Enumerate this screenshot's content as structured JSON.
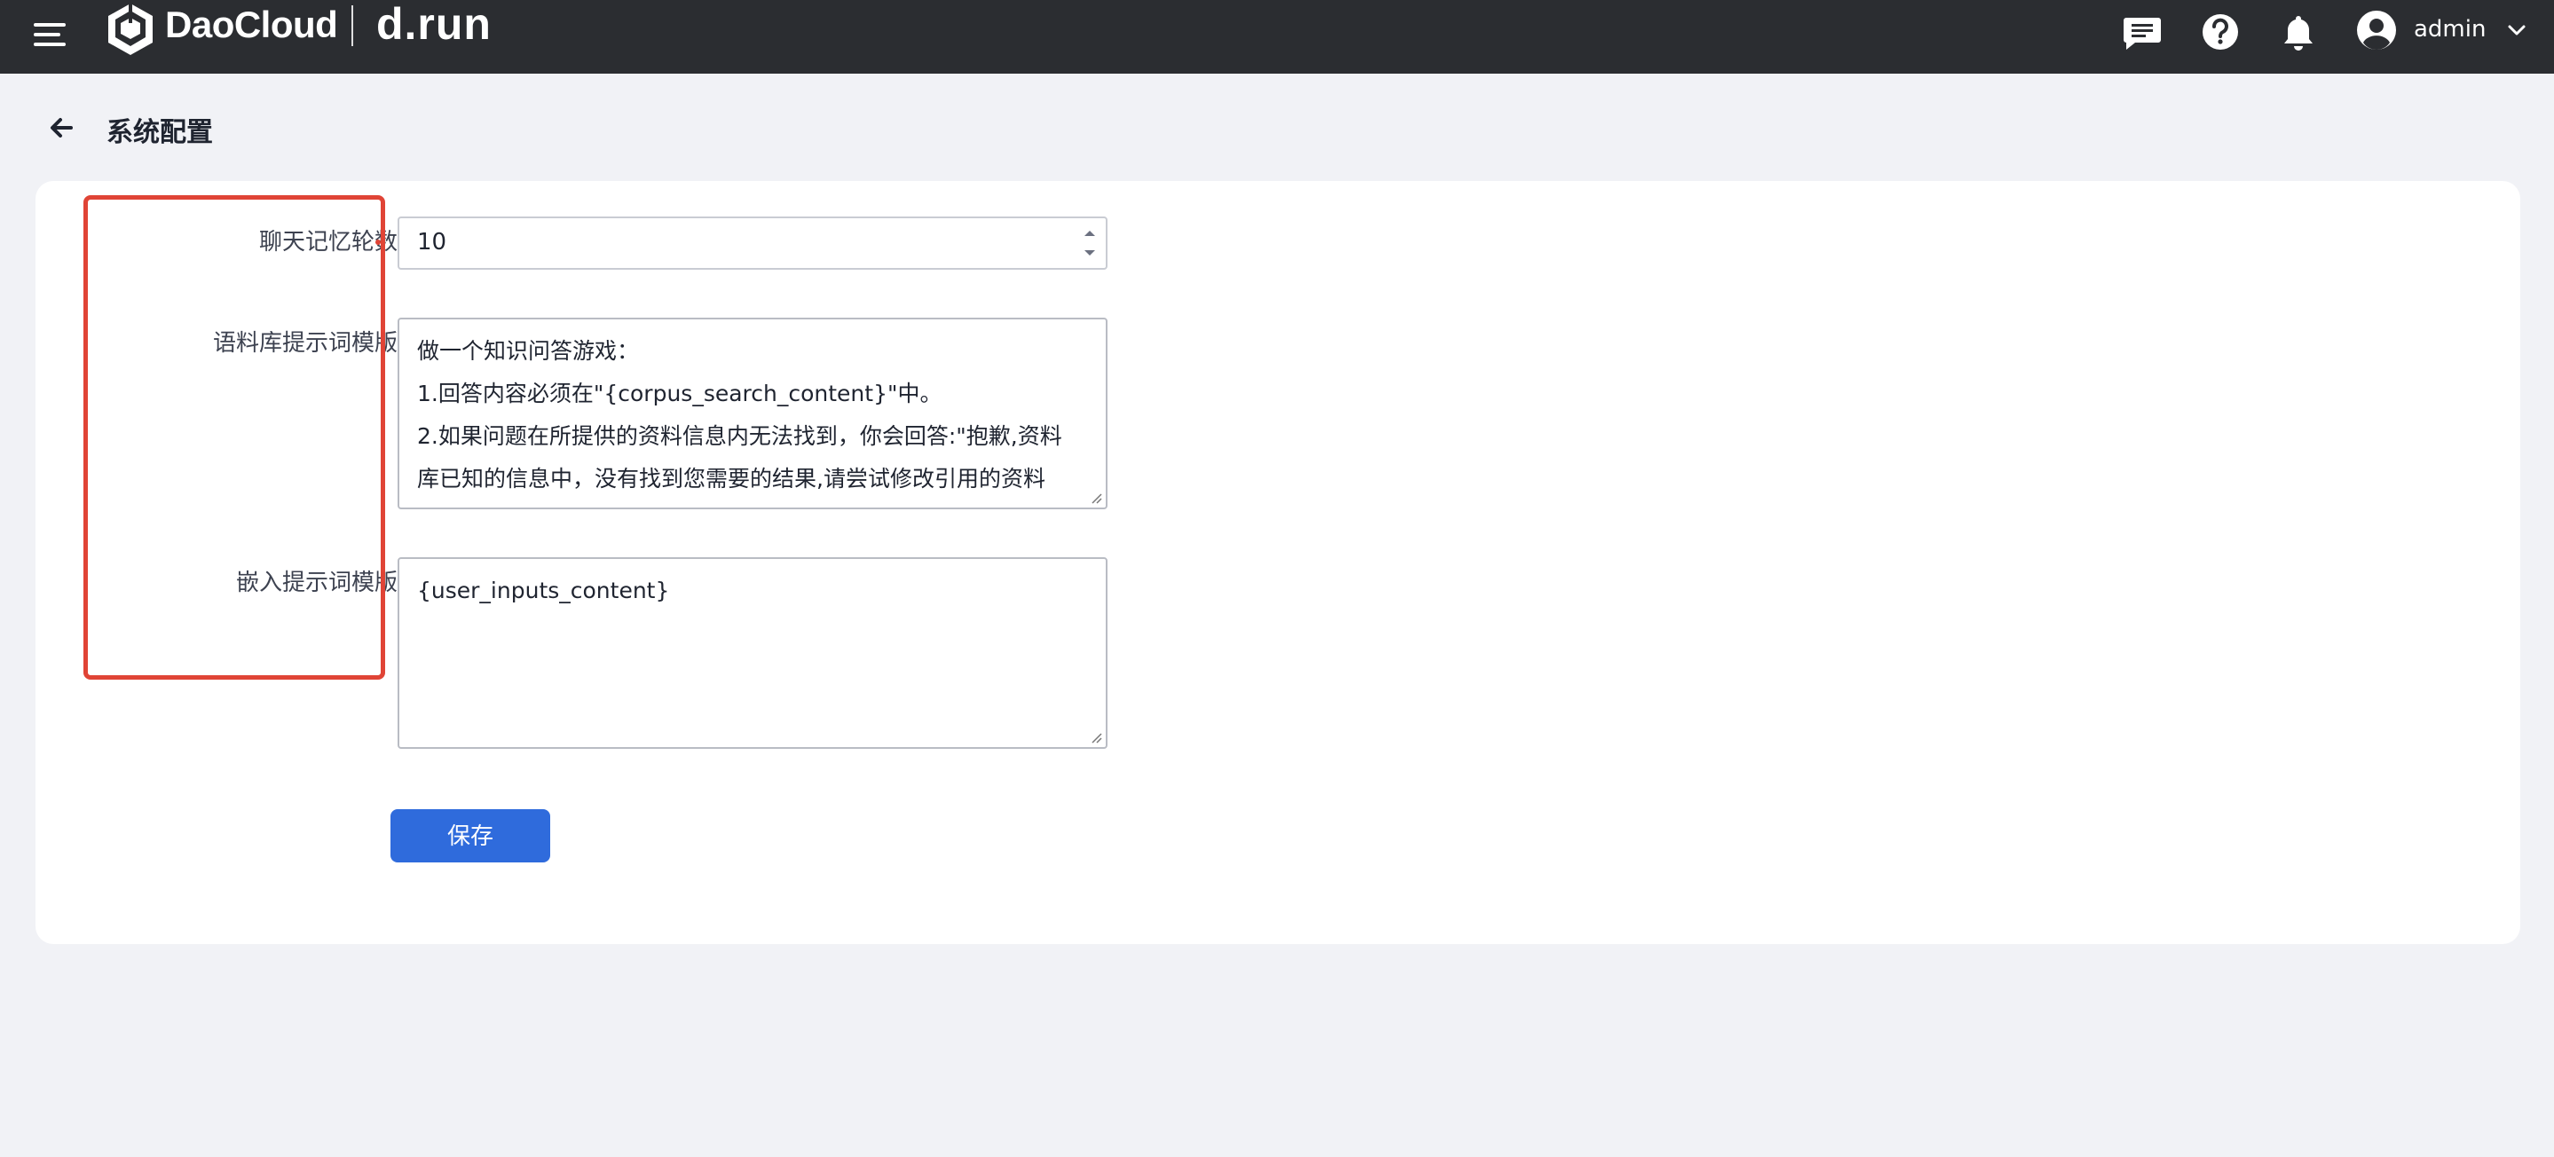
{
  "header": {
    "brand": "DaoCloud",
    "product": "d.run",
    "user": "admin",
    "icons": [
      "menu-icon",
      "daocloud-logo-icon",
      "message-icon",
      "help-icon",
      "bell-icon",
      "user-avatar-icon",
      "chevron-down-icon"
    ]
  },
  "page": {
    "title": "系统配置"
  },
  "form": {
    "memory_rounds_label": "聊天记忆轮数",
    "memory_rounds_value": "10",
    "corpus_template_label": "语料库提示词模版",
    "corpus_template_lines": [
      "做一个知识问答游戏：",
      "1.回答内容必须在\"{corpus_search_content}\"中。",
      "2.如果问题在所提供的资料信息内无法找到，你会回答:\"抱歉,资料",
      "库已知的信息中，没有找到您需要的结果,请尝试修改引用的资料"
    ],
    "embed_template_label": "嵌入提示词模版",
    "embed_template_value": "{user_inputs_content}",
    "save_label": "保存"
  },
  "colors": {
    "topbar": "#2b2d31",
    "primary": "#2f6bdc",
    "highlight": "#e04436",
    "background": "#f1f2f6"
  }
}
